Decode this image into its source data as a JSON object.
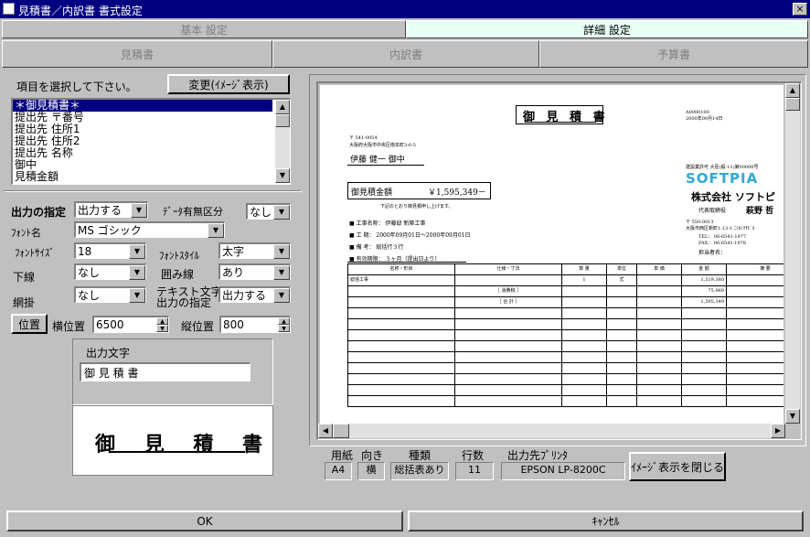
{
  "window": {
    "title": "見積書／内訳書 書式設定",
    "close": "×"
  },
  "tabs": [
    {
      "label": "基本 設定"
    },
    {
      "label": "詳細 設定"
    }
  ],
  "subtabs": [
    {
      "label": "見積書"
    },
    {
      "label": "内訳書"
    },
    {
      "label": "予算書"
    }
  ],
  "left": {
    "prompt": "項目を選択して下さい。",
    "change_button": "変更(ｲﾒｰｼﾞ表示)",
    "items": [
      "＊御見積書＊",
      "提出先 〒番号",
      "提出先 住所1",
      "提出先 住所2",
      "提出先 名称",
      "御中",
      "見積金額"
    ],
    "output_label": "出力の指定",
    "output_value": "出力する",
    "data_label": "ﾃﾞｰﾀ有無区分",
    "data_value": "なし",
    "font_label": "ﾌｫﾝﾄ名",
    "font_value": "MS ゴシック",
    "size_label": "ﾌｫﾝﾄｻｲｽﾞ",
    "size_value": "18",
    "style_label": "ﾌｫﾝﾄｽﾀｲﾙ",
    "style_value": "太字",
    "underline_label": "下線",
    "underline_value": "なし",
    "box_label": "囲み線",
    "box_value": "あり",
    "shade_label": "網掛",
    "shade_value": "なし",
    "text_output_label1": "テキスト文字の",
    "text_output_label2": "出力の指定",
    "text_output_value": "出力する",
    "position_button": "位置",
    "x_label": "横位置",
    "x_value": "6500",
    "y_label": "縦位置",
    "y_value": "800",
    "output_text_label": "出力文字",
    "output_text_value": "御 見 積 書",
    "preview_text": "御 見 積 書"
  },
  "doc": {
    "title": "御 見 積 書",
    "docno1": "A0000100",
    "docno2": "2000年09月14日",
    "zip": "〒 541-0054",
    "address": "大阪府大阪市中央区南本町3-6-5",
    "recipient": "伊藤 健一 御中",
    "amount_label": "御見積金額",
    "amount_value": "￥1,595,349－",
    "note": "下記のとおり御見積申し上げます。",
    "items": [
      "■ 工事名称： 伊藤邸 新築工事",
      "■ 工 期： 2000年09月01日～2000年09月01日",
      "■ 備 考： 総括行３行",
      "■ 有効期限： ３ヶ月（提出日より）"
    ],
    "company_no": "建設業許可 大臣(般-11)第00000号",
    "logo": "SOFTPIA",
    "company": "株式会社 ソフトピ",
    "rep_label": "代表取締役",
    "rep_name": "萩野 哲",
    "company_zip": "〒 550-0013",
    "company_addr": "大阪市西区新町1-13-1 ﾆｼﾎﾝﾏﾁﾋﾞﾙ",
    "tel": "TEL： 06-6541-1977",
    "fax": "FAX： 06-6541-1978",
    "staff": "担当者名：",
    "table_headers": [
      "名称・形状",
      "仕様・寸法",
      "数 量",
      "単位",
      "単 価",
      "金 額",
      "摘 要"
    ],
    "rows": [
      [
        "総括工事",
        "",
        "1",
        "式",
        "",
        "1,519,380",
        ""
      ],
      [
        "",
        "［ 消費税 ］",
        "",
        "",
        "",
        "75,969",
        ""
      ],
      [
        "",
        "［ 合 計 ］",
        "",
        "",
        "",
        "1,595,349",
        ""
      ]
    ]
  },
  "info": {
    "labels": [
      "用紙",
      "向き",
      "種類",
      "行数",
      "出力先ﾌﾟﾘﾝﾀ"
    ],
    "values": [
      "A4",
      "横",
      "総括表あり",
      "11",
      "EPSON LP-8200C"
    ],
    "close_button": "ｲﾒｰｼﾞ表示を閉じる"
  },
  "footer": {
    "ok": "OK",
    "cancel": "ｷｬﾝｾﾙ"
  }
}
